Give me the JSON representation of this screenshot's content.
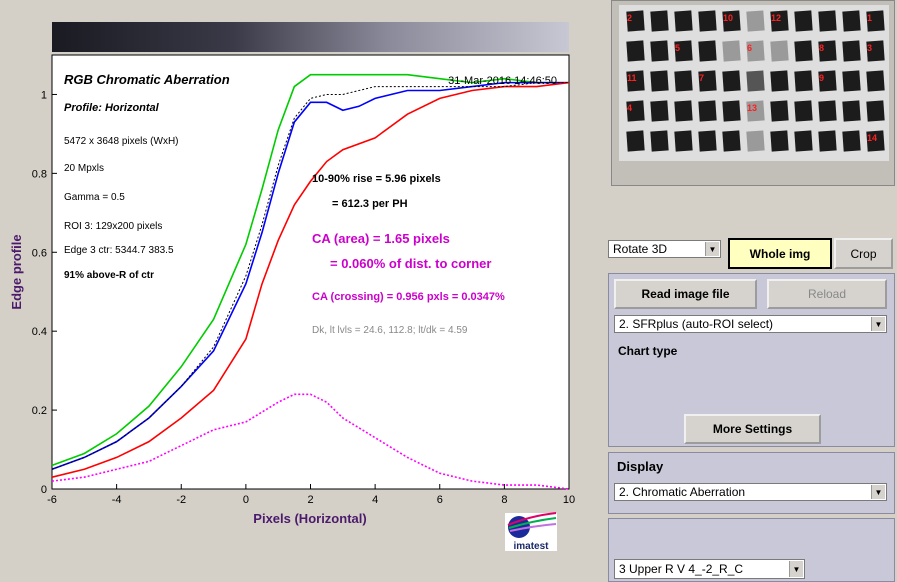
{
  "plot": {
    "title": "RGB Chromatic Aberration",
    "profile": "Profile: Horizontal",
    "datetime": "31-Mar-2016 14:46:50",
    "info_lines": [
      "5472 x 3648 pixels (WxH)",
      "20 Mpxls",
      "Gamma = 0.5",
      "ROI 3: 129x200 pixels",
      "Edge 3 ctr: 5344.7  383.5"
    ],
    "above_ctr": "91% above-R of ctr",
    "rise": "10-90% rise = 5.96 pixels",
    "per_ph": "= 612.3 per PH",
    "ca_area": "CA (area) = 1.65 pixels",
    "ca_area_pct": "= 0.060% of dist. to corner",
    "ca_crossing": "CA (crossing) = 0.956 pxls = 0.0347%",
    "dk_line": "Dk, lt lvls = 24.6, 112.8;  lt/dk = 4.59",
    "logo_text": "imatest",
    "colors": {
      "red": "#ff0000",
      "green": "#00cc00",
      "blue": "#0000ff",
      "magenta": "#ff00ff",
      "ca_text": "#cc00cc"
    }
  },
  "chart_data": {
    "type": "line",
    "xlabel": "Pixels (Horizontal)",
    "ylabel": "Edge profile",
    "xlim": [
      -6,
      10
    ],
    "ylim": [
      0,
      1.1
    ],
    "x_ticks": [
      "-6",
      "-4",
      "-2",
      "0",
      "2",
      "4",
      "6",
      "8",
      "10"
    ],
    "y_ticks": [
      "0",
      "0.2",
      "0.4",
      "0.6",
      "0.8",
      "1"
    ],
    "grid": false,
    "series": [
      {
        "color": "green",
        "x": [
          -6,
          -5,
          -4,
          -3,
          -2,
          -1,
          0,
          0.5,
          1,
          1.5,
          2,
          2.5,
          3,
          4,
          5,
          6,
          7,
          8,
          9,
          10
        ],
        "y": [
          0.06,
          0.09,
          0.14,
          0.21,
          0.31,
          0.43,
          0.62,
          0.76,
          0.91,
          1.02,
          1.05,
          1.05,
          1.05,
          1.05,
          1.05,
          1.04,
          1.03,
          1.04,
          1.03,
          1.03
        ]
      },
      {
        "color": "blue",
        "x": [
          -6,
          -5,
          -4,
          -3,
          -2,
          -1,
          0,
          0.5,
          1,
          1.5,
          2,
          2.5,
          3,
          3.5,
          4,
          5,
          6,
          7,
          8,
          9,
          10
        ],
        "y": [
          0.05,
          0.08,
          0.12,
          0.18,
          0.26,
          0.35,
          0.52,
          0.65,
          0.8,
          0.93,
          0.98,
          0.98,
          0.96,
          0.97,
          0.99,
          1.01,
          1.01,
          1.02,
          1.03,
          1.03,
          1.03
        ]
      },
      {
        "color": "red",
        "x": [
          -6,
          -5,
          -4,
          -3,
          -2,
          -1,
          0,
          0.5,
          1,
          1.5,
          2,
          2.5,
          3,
          4,
          5,
          6,
          7,
          8,
          9,
          10
        ],
        "y": [
          0.03,
          0.05,
          0.08,
          0.12,
          0.18,
          0.25,
          0.38,
          0.52,
          0.63,
          0.72,
          0.78,
          0.83,
          0.86,
          0.89,
          0.95,
          0.99,
          1.01,
          1.02,
          1.02,
          1.03
        ]
      },
      {
        "color": "black-dotted",
        "x": [
          -6,
          -5,
          -4,
          -3,
          -2,
          -1,
          0,
          0.5,
          1,
          1.5,
          2,
          2.5,
          3,
          4,
          5,
          6,
          7,
          8,
          9,
          10
        ],
        "y": [
          0.05,
          0.08,
          0.12,
          0.18,
          0.26,
          0.36,
          0.54,
          0.67,
          0.82,
          0.94,
          0.99,
          1.0,
          1.0,
          1.02,
          1.02,
          1.02,
          1.02,
          1.02,
          1.03,
          1.03
        ]
      },
      {
        "color": "magenta-dotted",
        "x": [
          -6,
          -5,
          -4,
          -3,
          -2,
          -1,
          0,
          1,
          1.5,
          2,
          2.5,
          3,
          4,
          5,
          6,
          7,
          8,
          9,
          10
        ],
        "y": [
          0.02,
          0.03,
          0.05,
          0.07,
          0.11,
          0.15,
          0.17,
          0.22,
          0.24,
          0.24,
          0.22,
          0.18,
          0.13,
          0.08,
          0.04,
          0.02,
          0.01,
          0.01,
          0.0
        ]
      }
    ]
  },
  "chart_image": {
    "roi_labels": [
      "2",
      "10",
      "12",
      "4",
      "5",
      "6",
      "8",
      "11",
      "7",
      "9",
      "13",
      "3",
      "1",
      "14"
    ]
  },
  "controls": {
    "rotate": "Rotate 3D",
    "whole_img": "Whole img",
    "crop": "Crop",
    "read_image": "Read image file",
    "reload": "Reload",
    "sfr_mode": "2. SFRplus (auto-ROI select)",
    "chart_type": "Chart type",
    "more_settings": "More Settings",
    "display_label": "Display",
    "display_value": "2.  Chromatic Aberration",
    "roi_select": "3  Upper R V   4_-2_R_C"
  }
}
